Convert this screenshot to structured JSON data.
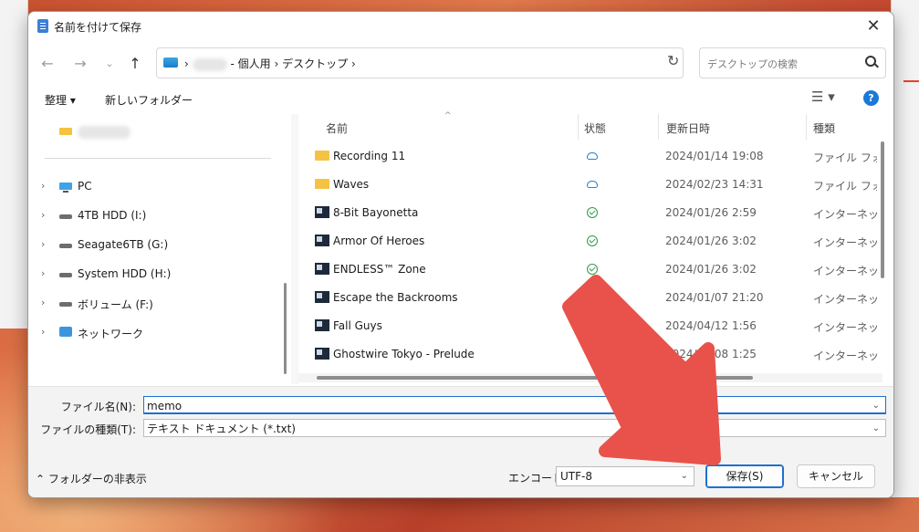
{
  "dialog": {
    "title": "名前を付けて保存",
    "address": {
      "sep1": "›",
      "segment1": "- 個人用",
      "sep2": "›",
      "segment2": "デスクトップ",
      "sep3": "›"
    },
    "search_placeholder": "デスクトップの検索",
    "toolbar": {
      "organize": "整理 ▾",
      "new_folder": "新しいフォルダー",
      "view": "☰ ▾",
      "help": "?"
    },
    "left_pane": {
      "items": [
        {
          "label": "PC",
          "icon": "monitor-icon"
        },
        {
          "label": "4TB HDD (I:)",
          "icon": "drive-icon"
        },
        {
          "label": "Seagate6TB (G:)",
          "icon": "drive-icon"
        },
        {
          "label": "System HDD (H:)",
          "icon": "drive-icon"
        },
        {
          "label": "ボリューム (F:)",
          "icon": "drive-icon"
        },
        {
          "label": "ネットワーク",
          "icon": "network-icon"
        }
      ]
    },
    "columns": {
      "name": "名前",
      "status": "状態",
      "date": "更新日時",
      "type": "種類"
    },
    "files": [
      {
        "name": "Recording 11",
        "status": "cloud",
        "date": "2024/01/14 19:08",
        "type": "ファイル フォルダー",
        "icon": "folder-icon"
      },
      {
        "name": "Waves",
        "status": "cloud",
        "date": "2024/02/23 14:31",
        "type": "ファイル フォルダー",
        "icon": "folder-icon"
      },
      {
        "name": "8-Bit Bayonetta",
        "status": "synced",
        "date": "2024/01/26 2:59",
        "type": "インターネット ショートカット",
        "icon": "game-shortcut-icon"
      },
      {
        "name": "Armor Of Heroes",
        "status": "synced",
        "date": "2024/01/26 3:02",
        "type": "インターネット ショートカット",
        "icon": "game-shortcut-icon"
      },
      {
        "name": "ENDLESS™ Zone",
        "status": "synced",
        "date": "2024/01/26 3:02",
        "type": "インターネット ショートカット",
        "icon": "game-shortcut-icon"
      },
      {
        "name": "Escape the Backrooms",
        "status": "synced",
        "date": "2024/01/07 21:20",
        "type": "インターネット ショートカット",
        "icon": "game-shortcut-icon"
      },
      {
        "name": "Fall Guys",
        "status": "synced",
        "date": "2024/04/12 1:56",
        "type": "インターネット ショートカット",
        "icon": "game-shortcut-icon"
      },
      {
        "name": "Ghostwire Tokyo - Prelude",
        "status": "synced",
        "date": "2024/01/08 1:25",
        "type": "インターネット ショートカット",
        "icon": "game-shortcut-icon"
      }
    ],
    "form": {
      "filename_label": "ファイル名(N):",
      "filename_value": "memo",
      "filetype_label": "ファイルの種類(T):",
      "filetype_value": "テキスト ドキュメント (*.txt)",
      "hide_folders": "フォルダーの非表示",
      "encoding_label": "エンコード:",
      "encoding_value": "UTF-8",
      "save": "保存(S)",
      "cancel": "キャンセル"
    },
    "colors": {
      "accent": "#1f6fd1",
      "arrow": "#e8524a"
    }
  }
}
